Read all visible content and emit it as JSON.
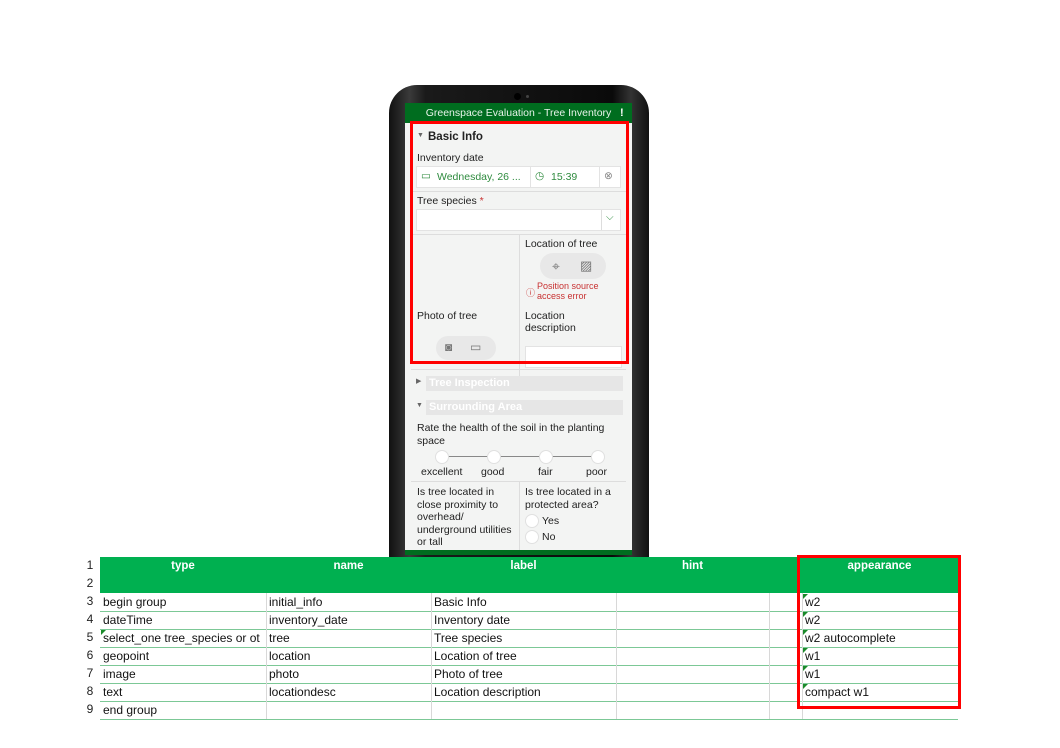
{
  "app": {
    "title": "Greenspace Evaluation - Tree Inventory",
    "status_icon": "signal-alert-icon"
  },
  "form": {
    "group1": {
      "title": "Basic Info",
      "expanded": true
    },
    "inventory_date": {
      "label": "Inventory date",
      "date_value": "Wednesday, 26 ...",
      "time_value": "15:39"
    },
    "tree_species": {
      "label": "Tree species",
      "required_mark": "*",
      "value": ""
    },
    "location": {
      "label": "Location of tree",
      "error": "Position source access error"
    },
    "photo": {
      "label": "Photo of tree"
    },
    "location_desc": {
      "label": "Location description",
      "value": ""
    },
    "group2": {
      "title": "Tree Inspection",
      "expanded": false
    },
    "group3": {
      "title": "Surrounding Area",
      "expanded": true
    },
    "soil_health": {
      "label": "Rate the health of the soil in the planting space",
      "options": [
        "excellent",
        "good",
        "fair",
        "poor"
      ]
    },
    "proximity": {
      "label": "Is tree located in close proximity to overhead/ underground utilities or tall"
    },
    "protected": {
      "label": "Is tree located in a protected area?",
      "options": [
        "Yes",
        "No"
      ]
    }
  },
  "sheet": {
    "row_numbers": [
      "1",
      "2",
      "3",
      "4",
      "5",
      "6",
      "7",
      "8",
      "9"
    ],
    "headers": [
      "type",
      "name",
      "label",
      "hint",
      "",
      "appearance"
    ],
    "rows": [
      [
        "begin group",
        "initial_info",
        "Basic Info",
        "",
        "",
        "w2"
      ],
      [
        "dateTime",
        "inventory_date",
        "Inventory date",
        "",
        "",
        "w2"
      ],
      [
        "select_one tree_species or ot",
        "tree",
        "Tree species",
        "",
        "",
        "w2 autocomplete"
      ],
      [
        "geopoint",
        "location",
        "Location of tree",
        "",
        "",
        "w1"
      ],
      [
        "image",
        "photo",
        "Photo of tree",
        "",
        "",
        "w1"
      ],
      [
        "text",
        "locationdesc",
        "Location description",
        "",
        "",
        "compact w1"
      ],
      [
        "end group",
        "",
        "",
        "",
        "",
        ""
      ]
    ]
  },
  "colors": {
    "header_green": "#00b050",
    "appbar_green": "#006d1f",
    "highlight": "#ff0000",
    "accent": "#2e8b3e",
    "error": "#c83232"
  }
}
